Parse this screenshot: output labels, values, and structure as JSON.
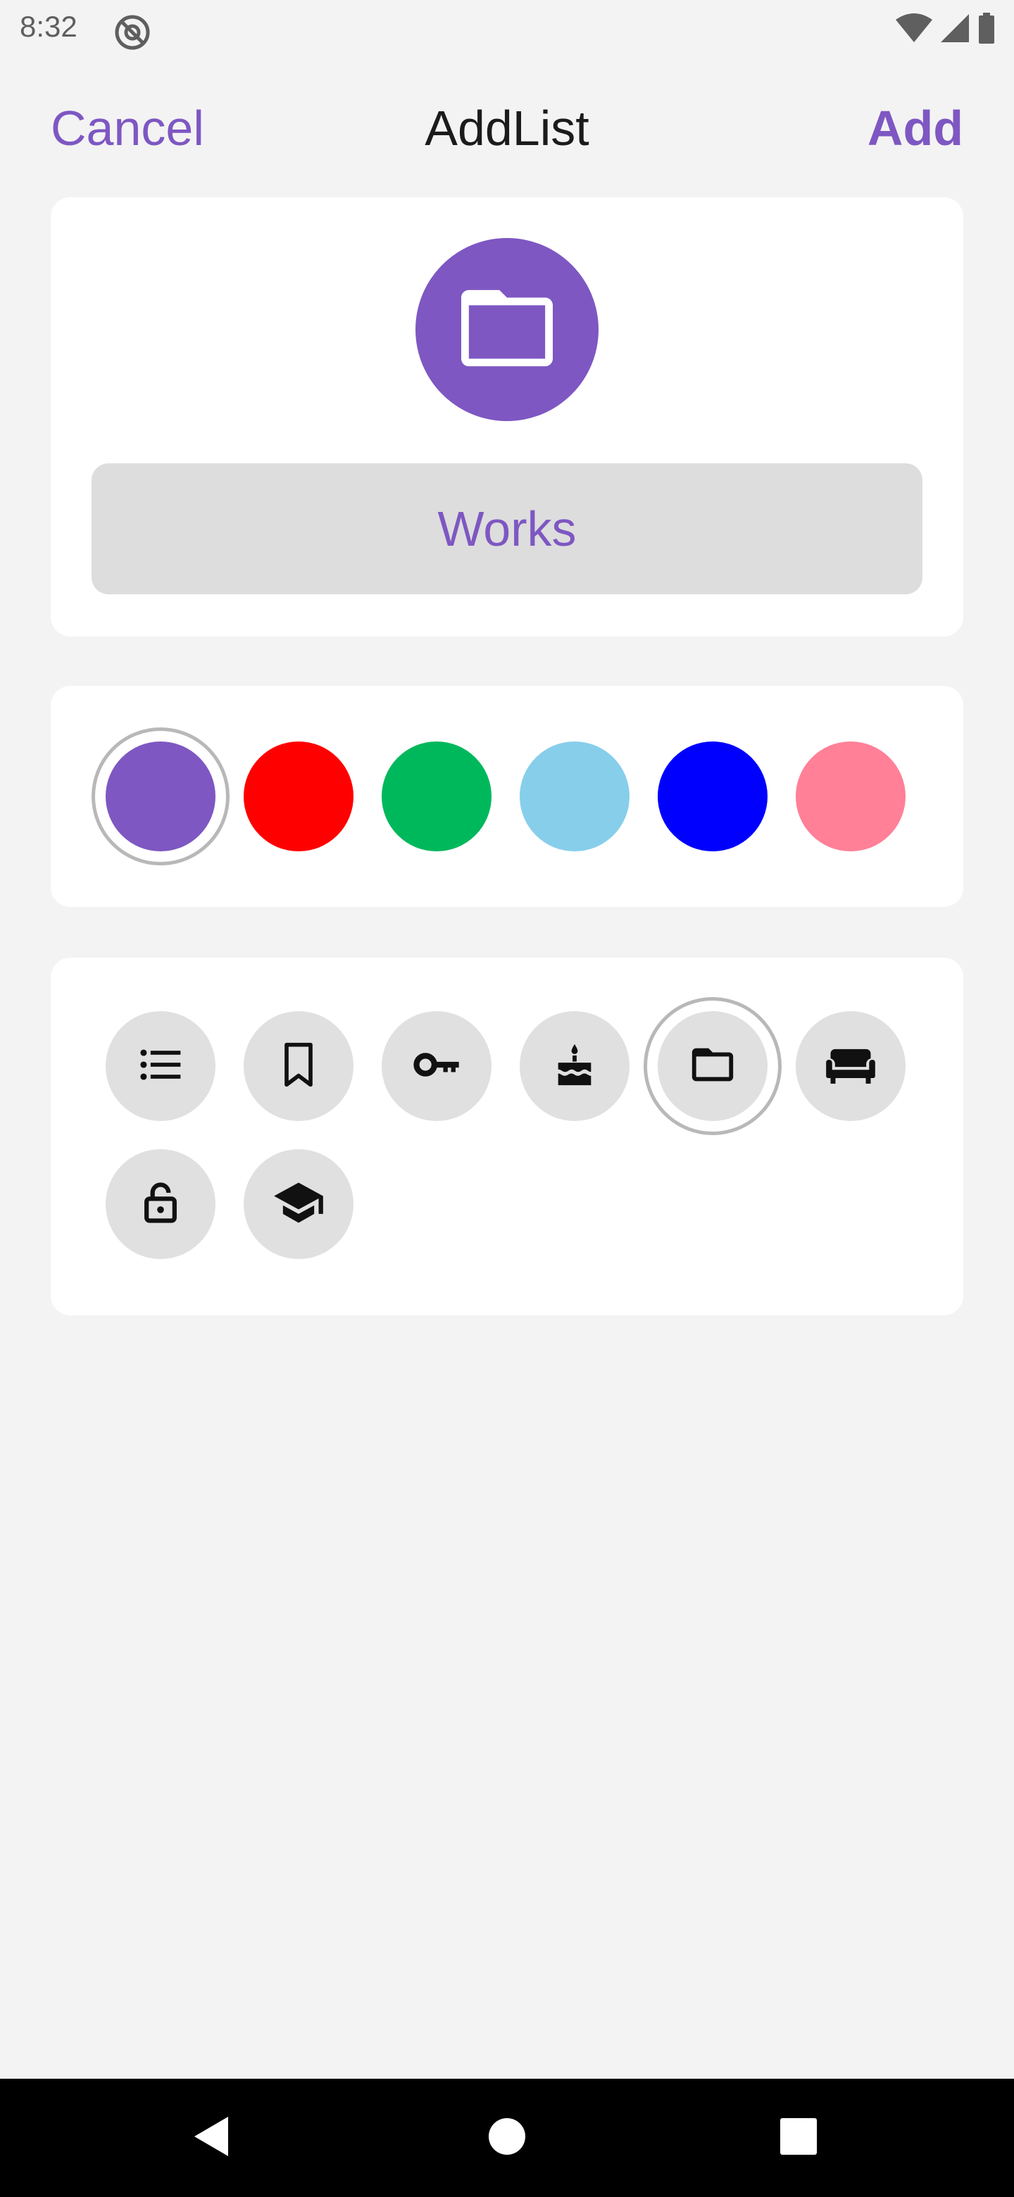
{
  "status_bar": {
    "time": "8:32",
    "left_icons": [
      "at-sign-icon"
    ],
    "right_icons": [
      "wifi-icon",
      "cell-signal-icon",
      "battery-icon"
    ]
  },
  "header": {
    "cancel_label": "Cancel",
    "title": "AddList",
    "add_label": "Add"
  },
  "preview": {
    "icon": "folder-icon",
    "name_value": "Works"
  },
  "colors": {
    "selected_index": 0,
    "swatches": [
      "#7e57c2",
      "#ff0000",
      "#00b85c",
      "#87ceeb",
      "#0000ff",
      "#ff8097"
    ]
  },
  "icons": {
    "selected_index": 4,
    "items": [
      "list-icon",
      "bookmark-icon",
      "key-icon",
      "cake-icon",
      "folder-icon",
      "sofa-icon",
      "lock-open-icon",
      "graduation-cap-icon"
    ]
  },
  "nav_bar": {
    "buttons": [
      "back-icon",
      "home-icon",
      "recents-icon"
    ]
  },
  "theme": {
    "accent": "#7e57c2",
    "background": "#f3f3f3",
    "card": "#ffffff",
    "field": "#dddddd",
    "icon_bg": "#e0e0e0",
    "ring": "#b8b8b8"
  }
}
